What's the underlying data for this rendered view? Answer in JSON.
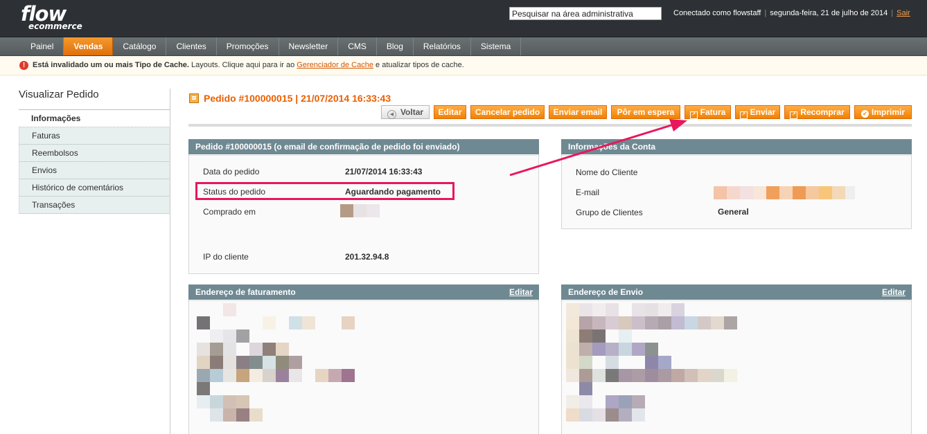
{
  "logo": {
    "main": "flow",
    "sub": "ecommerce"
  },
  "header": {
    "search_placeholder": "Pesquisar na área administrativa",
    "logged_in": "Conectado como flowstaff",
    "date": "segunda-feira, 21 de julho de 2014",
    "logout": "Sair"
  },
  "nav": {
    "items": [
      "Painel",
      "Vendas",
      "Catálogo",
      "Clientes",
      "Promoções",
      "Newsletter",
      "CMS",
      "Blog",
      "Relatórios",
      "Sistema"
    ],
    "active": "Vendas"
  },
  "notice": {
    "bold": "Está invalidado um ou mais Tipo de Cache.",
    "text1": " Layouts. Clique aqui para ir ao ",
    "link": "Gerenciador de Cache",
    "text2": " e atualizar tipos de cache."
  },
  "sidebar": {
    "title": "Visualizar Pedido",
    "tabs": [
      "Informações",
      "Faturas",
      "Reembolsos",
      "Envios",
      "Histórico de comentários",
      "Transações"
    ],
    "active": "Informações"
  },
  "page": {
    "title": "Pedido #100000015 | 21/07/2014 16:33:43",
    "buttons": {
      "back": "Voltar",
      "edit": "Editar",
      "cancel": "Cancelar pedido",
      "email": "Enviar email",
      "hold": "Pôr em espera",
      "invoice": "Fatura",
      "ship": "Enviar",
      "reorder": "Recomprar",
      "print": "Imprimir"
    }
  },
  "order_box": {
    "title": "Pedido #100000015 (o email de confirmação de pedido foi enviado)",
    "date_label": "Data do pedido",
    "date_value": "21/07/2014 16:33:43",
    "status_label": "Status do pedido",
    "status_value": "Aguardando pagamento",
    "purchased_label": "Comprado em",
    "ip_label": "IP do cliente",
    "ip_value": "201.32.94.8"
  },
  "account_box": {
    "title": "Informações da Conta",
    "name_label": "Nome do Cliente",
    "email_label": "E-mail",
    "group_label": "Grupo de Clientes",
    "group_value": "General"
  },
  "billing_box": {
    "title": "Endereço de faturamento",
    "edit": "Editar"
  },
  "shipping_box": {
    "title": "Endereço de Envio",
    "edit": "Editar"
  },
  "colors": {
    "accent": "#eb5e00",
    "button": "#f18200",
    "box_header": "#6f8992",
    "highlight": "#e8175d"
  }
}
